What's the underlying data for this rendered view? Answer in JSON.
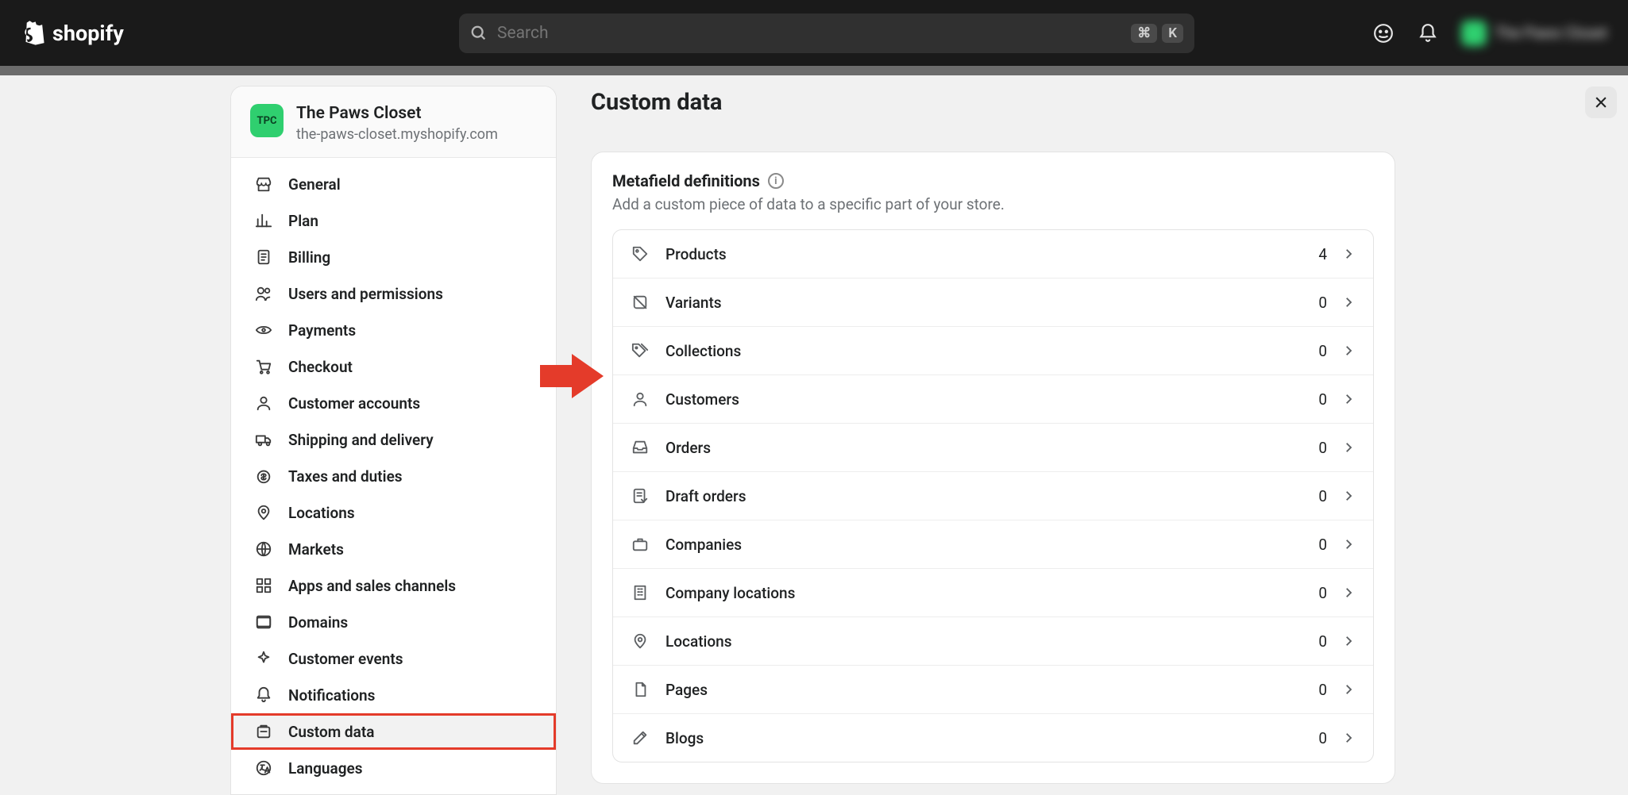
{
  "brand": {
    "name": "shopify"
  },
  "search": {
    "placeholder": "Search",
    "shortcut_mod": "⌘",
    "shortcut_key": "K"
  },
  "user": {
    "store_label": "The Paws Closet"
  },
  "store": {
    "name": "The Paws Closet",
    "url": "the-paws-closet.myshopify.com",
    "initials": "TPC"
  },
  "sidebar": {
    "items": [
      {
        "label": "General",
        "icon": "store-icon"
      },
      {
        "label": "Plan",
        "icon": "chart-icon"
      },
      {
        "label": "Billing",
        "icon": "receipt-icon"
      },
      {
        "label": "Users and permissions",
        "icon": "users-icon"
      },
      {
        "label": "Payments",
        "icon": "card-icon"
      },
      {
        "label": "Checkout",
        "icon": "cart-icon"
      },
      {
        "label": "Customer accounts",
        "icon": "person-icon"
      },
      {
        "label": "Shipping and delivery",
        "icon": "truck-icon"
      },
      {
        "label": "Taxes and duties",
        "icon": "money-icon"
      },
      {
        "label": "Locations",
        "icon": "pin-icon"
      },
      {
        "label": "Markets",
        "icon": "globe-icon"
      },
      {
        "label": "Apps and sales channels",
        "icon": "apps-icon"
      },
      {
        "label": "Domains",
        "icon": "domains-icon"
      },
      {
        "label": "Customer events",
        "icon": "sparkle-icon"
      },
      {
        "label": "Notifications",
        "icon": "bell-icon"
      },
      {
        "label": "Custom data",
        "icon": "data-icon",
        "selected": true,
        "highlight": true
      },
      {
        "label": "Languages",
        "icon": "language-icon"
      }
    ]
  },
  "main": {
    "title": "Custom data",
    "section_title": "Metafield definitions",
    "section_sub": "Add a custom piece of data to a specific part of your store.",
    "rows": [
      {
        "label": "Products",
        "count": "4",
        "icon": "tag-icon"
      },
      {
        "label": "Variants",
        "count": "0",
        "icon": "variant-icon"
      },
      {
        "label": "Collections",
        "count": "0",
        "icon": "tags-icon"
      },
      {
        "label": "Customers",
        "count": "0",
        "icon": "person-icon"
      },
      {
        "label": "Orders",
        "count": "0",
        "icon": "inbox-icon"
      },
      {
        "label": "Draft orders",
        "count": "0",
        "icon": "draft-icon"
      },
      {
        "label": "Companies",
        "count": "0",
        "icon": "briefcase-icon"
      },
      {
        "label": "Company locations",
        "count": "0",
        "icon": "building-icon"
      },
      {
        "label": "Locations",
        "count": "0",
        "icon": "pin-icon"
      },
      {
        "label": "Pages",
        "count": "0",
        "icon": "page-icon"
      },
      {
        "label": "Blogs",
        "count": "0",
        "icon": "edit-icon"
      }
    ]
  }
}
